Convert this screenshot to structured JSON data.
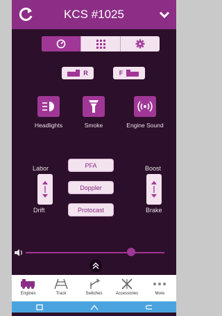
{
  "header": {
    "title": "KCS #1025"
  },
  "direction": {
    "reverse_label": "R",
    "forward_label": "F"
  },
  "functions": [
    {
      "label": "Headlights"
    },
    {
      "label": "Smoke"
    },
    {
      "label": "Engine Sound"
    }
  ],
  "side_controls": {
    "left_top": "Labor",
    "left_bottom": "Drift",
    "right_top": "Boost",
    "right_bottom": "Brake"
  },
  "sound_buttons": [
    {
      "label": "PFA"
    },
    {
      "label": "Doppler"
    },
    {
      "label": "Protocast"
    }
  ],
  "volume": {
    "level": 0.75
  },
  "bottom_nav": [
    {
      "label": "Engines",
      "icon": "locomotive-icon",
      "color": "#8c2e86"
    },
    {
      "label": "Track",
      "icon": "track-icon"
    },
    {
      "label": "Switches",
      "icon": "switch-icon"
    },
    {
      "label": "Accessories",
      "icon": "accessories-icon"
    },
    {
      "label": "More",
      "icon": "more-icon"
    }
  ],
  "colors": {
    "accent": "#a03796",
    "header": "#8c2e86",
    "background": "#2c0f2a",
    "system_bar": "#4aa3df"
  }
}
